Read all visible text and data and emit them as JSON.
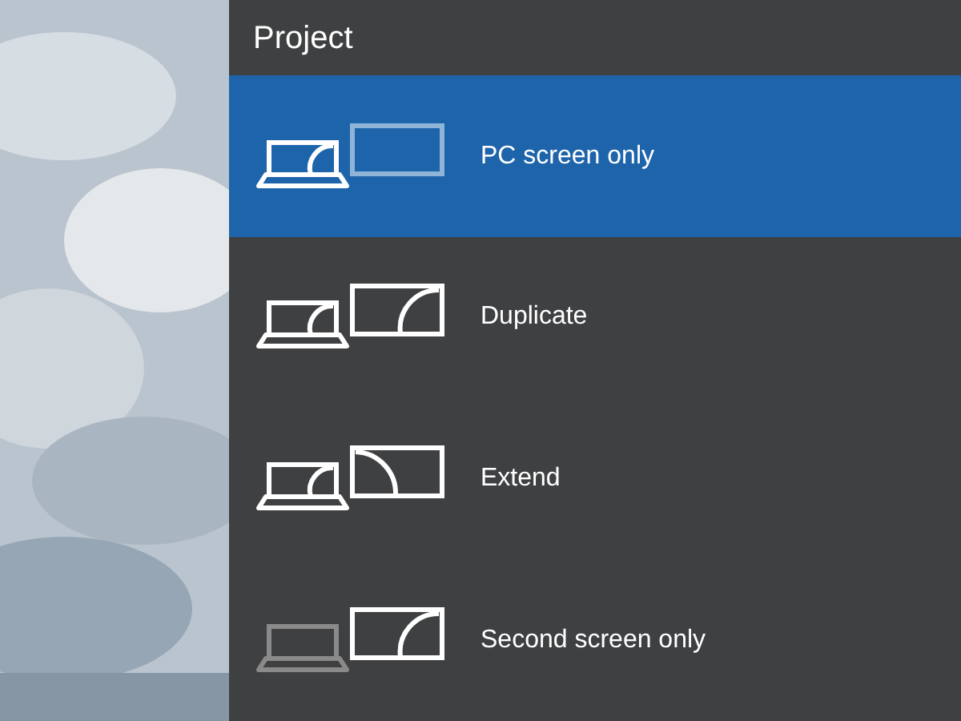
{
  "panel": {
    "title": "Project",
    "options": [
      {
        "kind": "pc_only",
        "label": "PC screen only",
        "selected": true
      },
      {
        "kind": "duplicate",
        "label": "Duplicate",
        "selected": false
      },
      {
        "kind": "extend",
        "label": "Extend",
        "selected": false
      },
      {
        "kind": "second_only",
        "label": "Second screen only",
        "selected": false
      }
    ]
  }
}
